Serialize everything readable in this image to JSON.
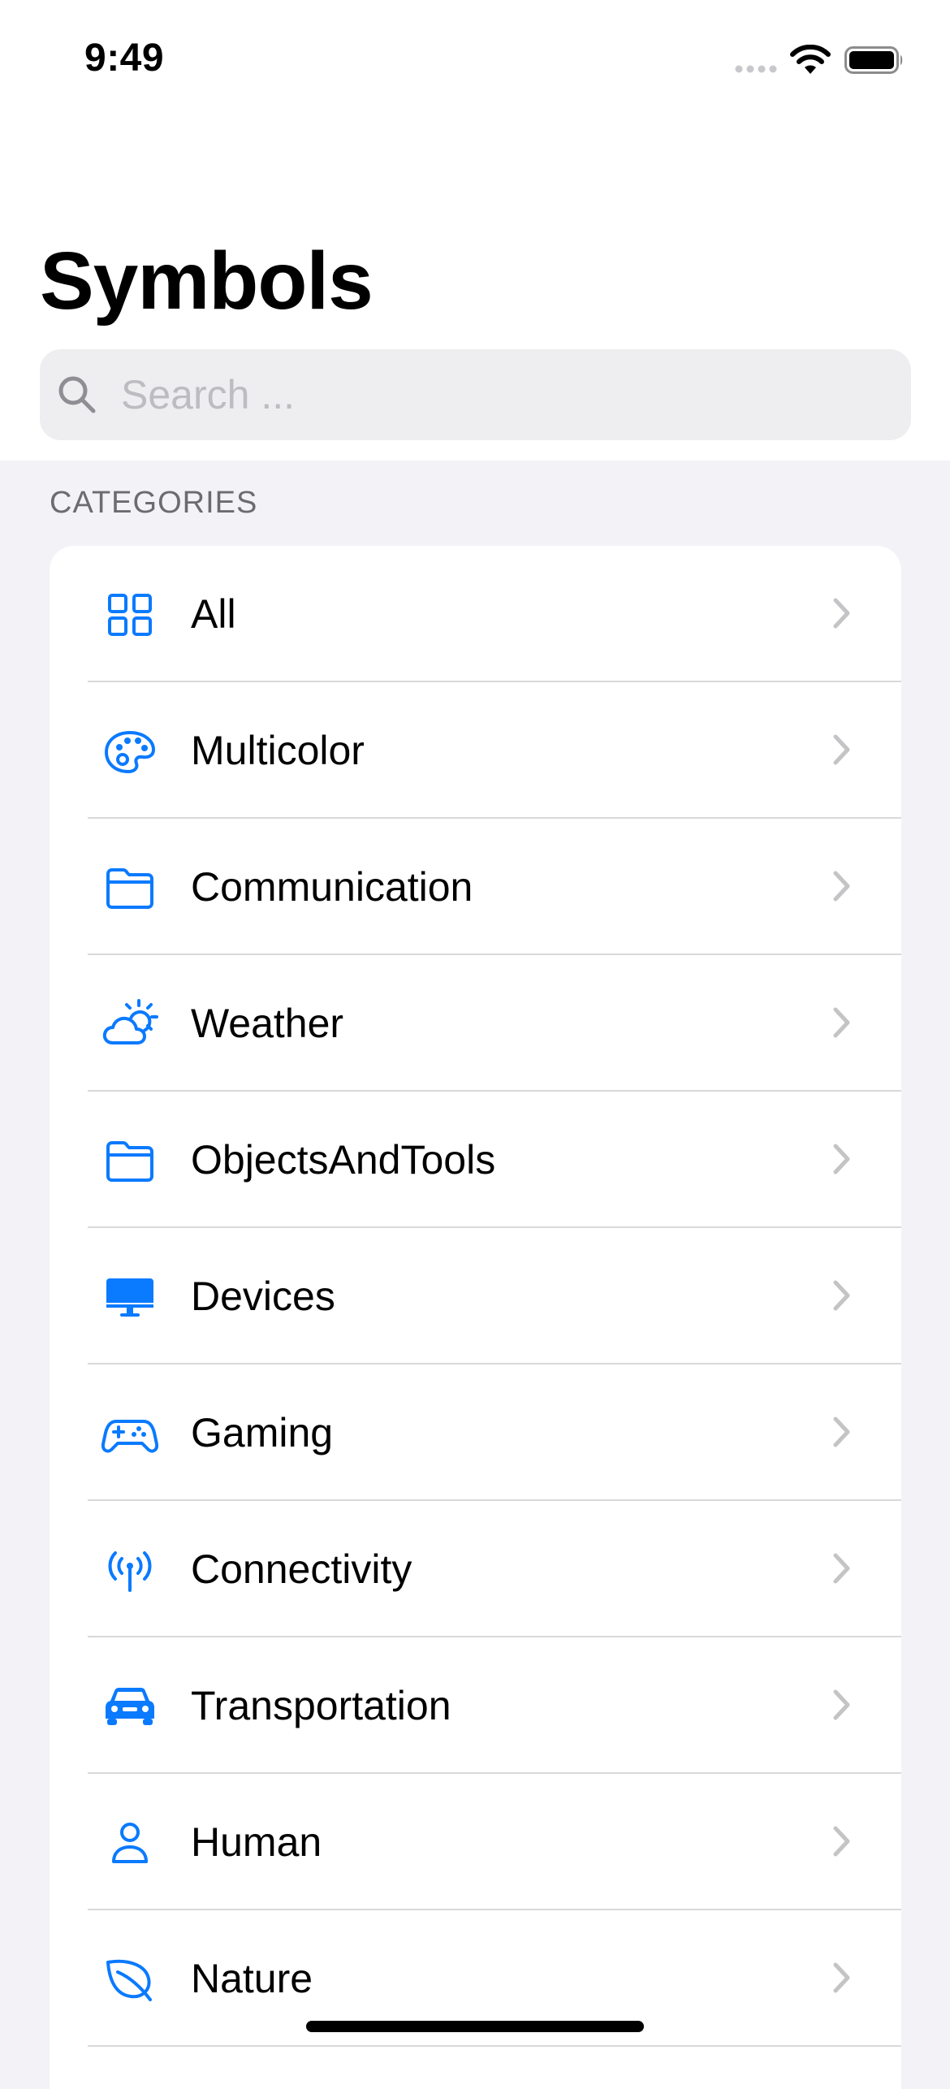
{
  "status_bar": {
    "time": "9:49"
  },
  "header": {
    "title": "Symbols"
  },
  "search": {
    "placeholder": "Search ..."
  },
  "list": {
    "section_header": "CATEGORIES",
    "items": [
      {
        "label": "All",
        "icon": "square-grid-2x2-icon"
      },
      {
        "label": "Multicolor",
        "icon": "paintpalette-icon"
      },
      {
        "label": "Communication",
        "icon": "folder-icon"
      },
      {
        "label": "Weather",
        "icon": "cloud-sun-icon"
      },
      {
        "label": "ObjectsAndTools",
        "icon": "folder-icon"
      },
      {
        "label": "Devices",
        "icon": "desktopcomputer-icon"
      },
      {
        "label": "Gaming",
        "icon": "gamecontroller-icon"
      },
      {
        "label": "Connectivity",
        "icon": "antenna-radiowaves-icon"
      },
      {
        "label": "Transportation",
        "icon": "car-icon"
      },
      {
        "label": "Human",
        "icon": "person-icon"
      },
      {
        "label": "Nature",
        "icon": "leaf-icon"
      }
    ]
  },
  "colors": {
    "accent": "#0a7aff",
    "chevron": "#c4c4c7",
    "background": "#f2f2f7"
  }
}
